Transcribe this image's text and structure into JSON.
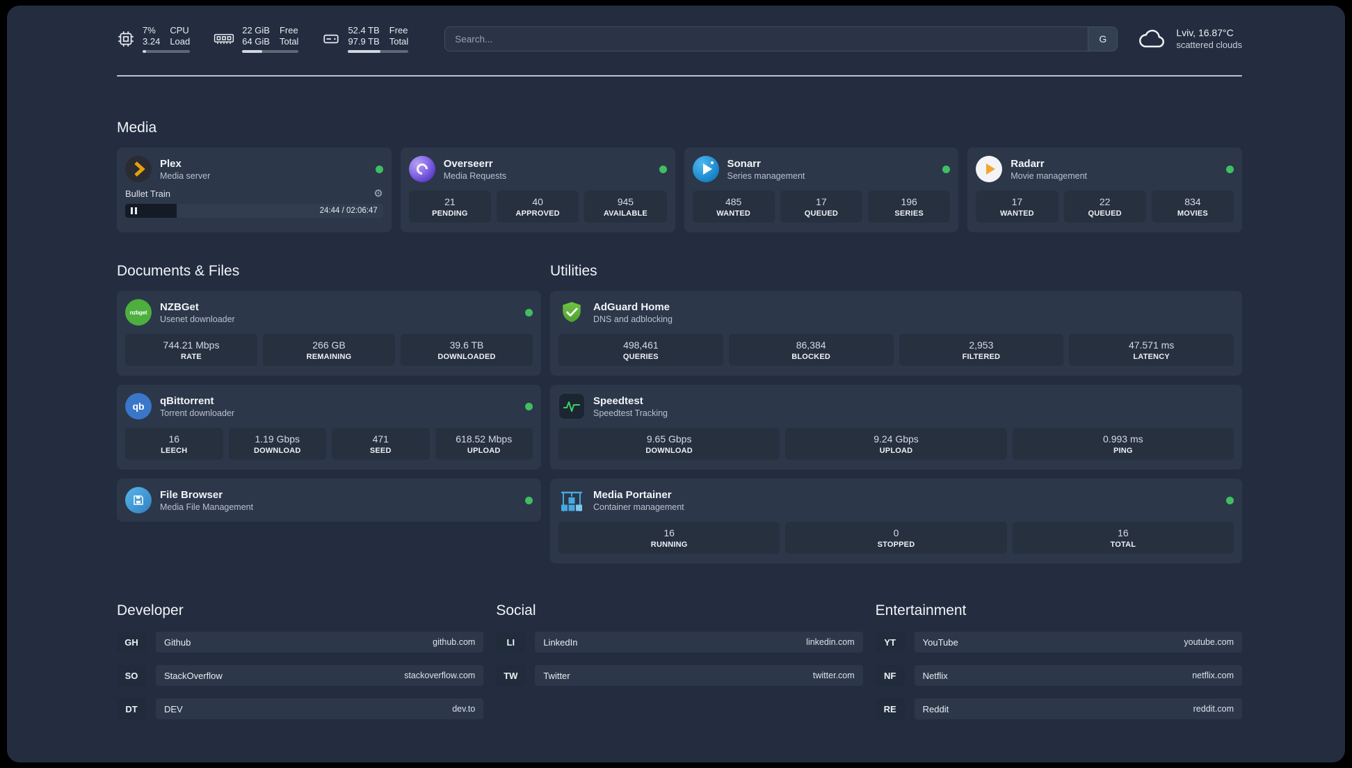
{
  "header": {
    "cpu": {
      "value_primary": "7%",
      "value_secondary": "3.24",
      "label_primary": "CPU",
      "label_secondary": "Load",
      "progress_pct": 7
    },
    "memory": {
      "value_primary": "22 GiB",
      "value_secondary": "64 GiB",
      "label_primary": "Free",
      "label_secondary": "Total",
      "progress_pct": 35
    },
    "storage": {
      "value_primary": "52.4 TB",
      "value_secondary": "97.9 TB",
      "label_primary": "Free",
      "label_secondary": "Total",
      "progress_pct": 54
    },
    "search": {
      "placeholder": "Search...",
      "engine_button": "G"
    },
    "weather": {
      "location": "Lviv, 16.87°C",
      "condition": "scattered clouds"
    }
  },
  "colors": {
    "accent_green": "#3fbf62",
    "plex_amber": "#e5a00d",
    "page_bg": "#232d3f",
    "card_bg": "#2c3749"
  },
  "sections": {
    "media": {
      "title": "Media",
      "plex": {
        "title": "Plex",
        "subtitle": "Media server",
        "now_playing": {
          "track": "Bullet Train",
          "time": "24:44 / 02:06:47",
          "progress_pct": 20
        }
      },
      "overseerr": {
        "title": "Overseerr",
        "subtitle": "Media Requests",
        "stats": [
          {
            "value": "21",
            "label": "PENDING"
          },
          {
            "value": "40",
            "label": "APPROVED"
          },
          {
            "value": "945",
            "label": "AVAILABLE"
          }
        ]
      },
      "sonarr": {
        "title": "Sonarr",
        "subtitle": "Series management",
        "stats": [
          {
            "value": "485",
            "label": "WANTED"
          },
          {
            "value": "17",
            "label": "QUEUED"
          },
          {
            "value": "196",
            "label": "SERIES"
          }
        ]
      },
      "radarr": {
        "title": "Radarr",
        "subtitle": "Movie management",
        "stats": [
          {
            "value": "17",
            "label": "WANTED"
          },
          {
            "value": "22",
            "label": "QUEUED"
          },
          {
            "value": "834",
            "label": "MOVIES"
          }
        ]
      }
    },
    "documents": {
      "title": "Documents & Files",
      "nzbget": {
        "title": "NZBGet",
        "subtitle": "Usenet downloader",
        "stats": [
          {
            "value": "744.21 Mbps",
            "label": "RATE"
          },
          {
            "value": "266 GB",
            "label": "REMAINING"
          },
          {
            "value": "39.6 TB",
            "label": "DOWNLOADED"
          }
        ]
      },
      "qbittorrent": {
        "title": "qBittorrent",
        "subtitle": "Torrent downloader",
        "stats": [
          {
            "value": "16",
            "label": "LEECH"
          },
          {
            "value": "1.19 Gbps",
            "label": "DOWNLOAD"
          },
          {
            "value": "471",
            "label": "SEED"
          },
          {
            "value": "618.52 Mbps",
            "label": "UPLOAD"
          }
        ]
      },
      "filebrowser": {
        "title": "File Browser",
        "subtitle": "Media File Management"
      }
    },
    "utilities": {
      "title": "Utilities",
      "adguard": {
        "title": "AdGuard Home",
        "subtitle": "DNS and adblocking",
        "stats": [
          {
            "value": "498,461",
            "label": "QUERIES"
          },
          {
            "value": "86,384",
            "label": "BLOCKED"
          },
          {
            "value": "2,953",
            "label": "FILTERED"
          },
          {
            "value": "47.571 ms",
            "label": "LATENCY"
          }
        ]
      },
      "speedtest": {
        "title": "Speedtest",
        "subtitle": "Speedtest Tracking",
        "stats": [
          {
            "value": "9.65 Gbps",
            "label": "DOWNLOAD"
          },
          {
            "value": "9.24 Gbps",
            "label": "UPLOAD"
          },
          {
            "value": "0.993 ms",
            "label": "PING"
          }
        ]
      },
      "portainer": {
        "title": "Media Portainer",
        "subtitle": "Container management",
        "stats": [
          {
            "value": "16",
            "label": "RUNNING"
          },
          {
            "value": "0",
            "label": "STOPPED"
          },
          {
            "value": "16",
            "label": "TOTAL"
          }
        ]
      }
    },
    "bookmarks": {
      "developer": {
        "title": "Developer",
        "items": [
          {
            "abbr": "GH",
            "name": "Github",
            "url": "github.com"
          },
          {
            "abbr": "SO",
            "name": "StackOverflow",
            "url": "stackoverflow.com"
          },
          {
            "abbr": "DT",
            "name": "DEV",
            "url": "dev.to"
          }
        ]
      },
      "social": {
        "title": "Social",
        "items": [
          {
            "abbr": "LI",
            "name": "LinkedIn",
            "url": "linkedin.com"
          },
          {
            "abbr": "TW",
            "name": "Twitter",
            "url": "twitter.com"
          }
        ]
      },
      "entertainment": {
        "title": "Entertainment",
        "items": [
          {
            "abbr": "YT",
            "name": "YouTube",
            "url": "youtube.com"
          },
          {
            "abbr": "NF",
            "name": "Netflix",
            "url": "netflix.com"
          },
          {
            "abbr": "RE",
            "name": "Reddit",
            "url": "reddit.com"
          }
        ]
      }
    }
  }
}
